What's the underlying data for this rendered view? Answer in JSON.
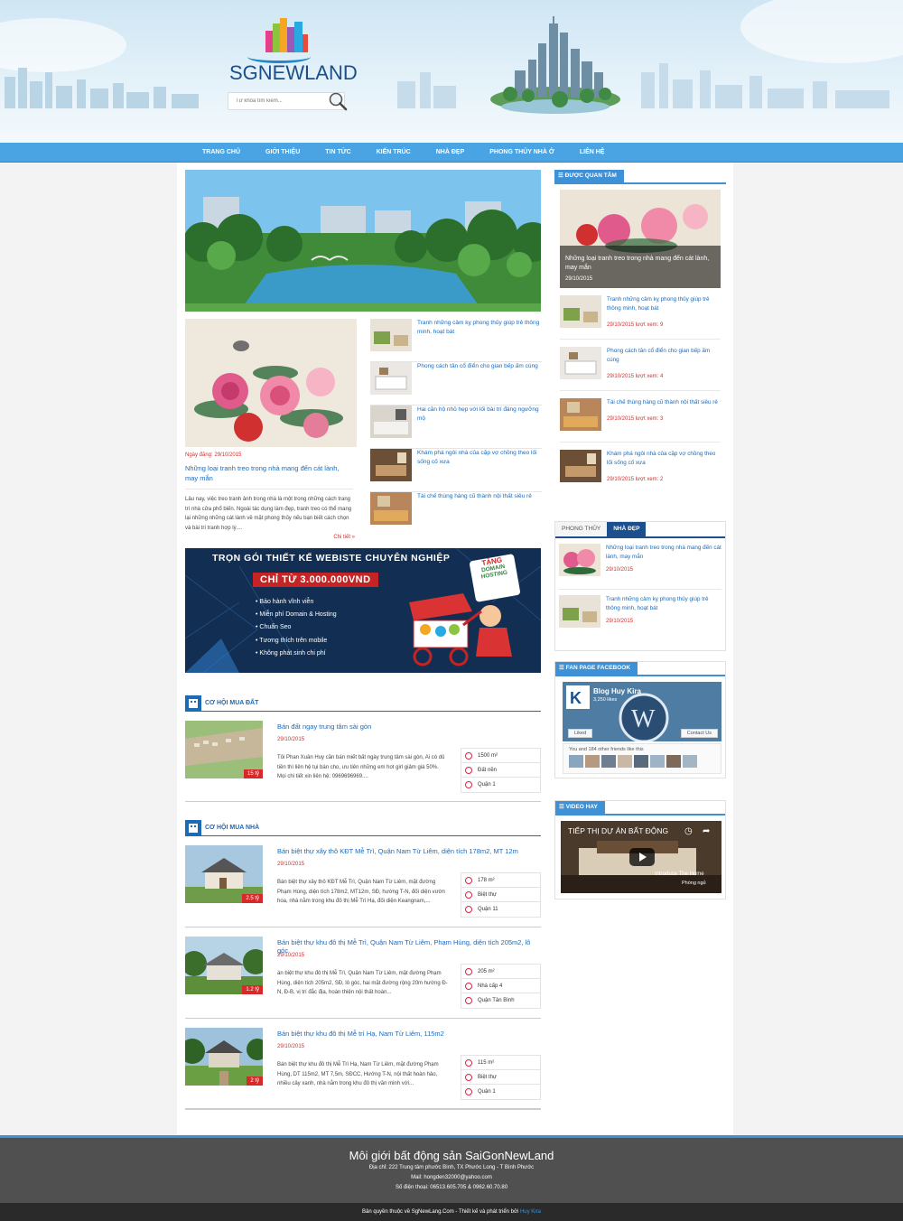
{
  "header": {
    "logo_text": "SGNEWLAND",
    "search_placeholder": "Từ khóa tìm kiếm..."
  },
  "nav": [
    "TRANG CHỦ",
    "GIỚI THIỆU",
    "TIN TỨC",
    "KIẾN TRÚC",
    "NHÀ ĐẸP",
    "PHONG THỦY NHÀ Ở",
    "LIÊN HỆ"
  ],
  "featured": {
    "date": "Ngày đăng: 29/10/2015",
    "title": "Những loại tranh treo trong nhà mang đến cát lành, may mắn",
    "excerpt": "Lâu nay, việc treo tranh ảnh trong nhà là một trong những cách trang trí nhà cửa phổ biến. Ngoài tác dụng làm đẹp, tranh treo có thể mang lại những những cát lành về mặt phong thủy nếu bạn biết cách chọn và bài trí tranh hợp lý....",
    "more": "Chi tiết »"
  },
  "small_list": [
    "Tranh những cảm kỵ phong thủy giúp trẻ thông minh, hoạt bát",
    "Phong cách tân cổ điển cho gian bếp ấm cúng",
    "Hai căn hộ nhỏ hẹp với lối bài trí đáng ngưỡng mộ",
    "Khám phá ngôi nhà của cặp vợ chồng theo lối sống cố xưa",
    "Tái chế thùng hàng cũ thành nội thất siêu rẻ"
  ],
  "banner": {
    "headline": "TRỌN GÓI THIẾT KẾ WEBISTE CHUYÊN NGHIỆP",
    "price": "CHỈ TỪ 3.000.000VND",
    "gift": [
      "TẶNG",
      "DOMAIN",
      "HOSTING"
    ],
    "features": [
      "Bảo hành vĩnh viễn",
      "Miễn phí Domain & Hosting",
      "Chuẩn Seo",
      "Tương thích trên mobile",
      "Không phát sinh chi phí"
    ]
  },
  "section_land": {
    "title": "CƠ HỘI MUA ĐẤT",
    "items": [
      {
        "title": "Bán đất ngay trung tâm sài gòn",
        "date": "29/10/2015",
        "desc": "Tôi Phan Xuân Huy cần bán miết bất ngày trung tâm sài gòn, Ai có dủ tiền thì liên hệ tụi bán cho, ưu tiên những em hot girl giảm giá 50%. Mọi chi tiết xin liên hệ: 0969696969....",
        "price": "15 tỷ",
        "area": "1500 m²",
        "type": "Đất nền",
        "district": "Quận 1"
      }
    ]
  },
  "section_house": {
    "title": "CƠ HỘI MUA NHÀ",
    "items": [
      {
        "title": "Bán biệt thự xây thô KĐT Mễ Trì, Quận Nam Từ Liêm, diện tích 178m2, MT 12m",
        "date": "29/10/2015",
        "desc": "Bán biệt thự xây thô KĐT Mễ Trì, Quận Nam Từ Liêm, mặt đường Phạm Hùng, diện tích 178m2, MT12m, SĐ, hướng T-N, đối diện vườn hoa, nhà nằm trong khu đô thị Mễ Trì Hạ, đối diện Keangnam,...",
        "price": "2.5 tỷ",
        "area": "178 m²",
        "type": "Biệt thự",
        "district": "Quận 11"
      },
      {
        "title": "Bán biệt thự khu đô thị Mễ Trì, Quận Nam Từ Liêm, Phạm Hùng, diện tích 205m2, lô góc",
        "date": "29/10/2015",
        "desc": "án biệt thự khu đô thị Mễ Trì, Quận Nam Từ Liêm, mặt đường Phạm Hùng, diện tích 205m2, SĐ, lô góc, hai mặt đường rộng 20m hướng Đ-N, Đ-B, vị trí đắc địa, hoàn thiện nội thất hoàn...",
        "price": "1.2 tỷ",
        "area": "205 m²",
        "type": "Nhà cấp 4",
        "district": "Quận Tân Bình"
      },
      {
        "title": "Bán biệt thự khu đô thị Mễ trì Hạ, Nam Từ Liêm, 115m2",
        "date": "29/10/2015",
        "desc": "Bán biệt thự khu đô thị Mễ Trì Hạ, Nam Từ Liêm, mặt đường Phạm Hùng, DT 115m2, MT 7,5m, SĐCC, Hướng T-N, nội thất hoàn hảo, nhiều cây xanh, nhà nằm trong khu đô thị văn minh với...",
        "price": "2 tỷ",
        "area": "115 m²",
        "type": "Biệt thự",
        "district": "Quận 1"
      }
    ]
  },
  "sidebar": {
    "popular_title": "ĐƯỢC QUAN TÂM",
    "popular_feature": {
      "title": "Những loại tranh treo trong nhà mang đến cát lành, may mắn",
      "date": "29/10/2015"
    },
    "popular_items": [
      {
        "title": "Tranh những cảm kỵ phong thủy giúp trẻ thông minh, hoạt bát",
        "meta": "29/10/2015 lượt xem: 9"
      },
      {
        "title": "Phong cách tân cổ điển cho gian bếp ấm cúng",
        "meta": "29/10/2015 lượt xem: 4"
      },
      {
        "title": "Tái chế thùng hàng cũ thành nội thất siêu rẻ",
        "meta": "29/10/2015 lượt xem: 3"
      },
      {
        "title": "Khám phá ngôi nhà của cặp vợ chồng theo lối sống cố xưa",
        "meta": "29/10/2015 lượt xem: 2"
      }
    ],
    "tabs": [
      "PHONG THỦY",
      "NHÀ ĐẸP"
    ],
    "tab_items": [
      {
        "title": "Những loại tranh treo trong nhà mang đến cát lành, may mắn",
        "date": "29/10/2015"
      },
      {
        "title": "Tranh những cảm kỵ phong thủy giúp trẻ thông minh, hoạt bát",
        "date": "29/10/2015"
      }
    ],
    "fanpage_title": "FAN PAGE FACEBOOK",
    "fb": {
      "name": "Blog Huy Kira",
      "likes": "3,250 likes",
      "liked": "Liked",
      "contact": "Contact Us",
      "friends": "You and 184 other friends like this"
    },
    "video_title": "VIDEO HAY",
    "video": {
      "title": "TIẾP THỊ DỰ ÁN BẤT ĐỘNG",
      "caption1": "Introduce The Home",
      "caption2": "Phòng ngủ"
    }
  },
  "footer": {
    "title": "Môi giới bất động sản SaiGonNewLand",
    "address": "Địa chỉ: 222 Trung tâm phước Bình, TX Phước Long - T Bình Phước",
    "mail": "Mail: hongden32000@yahoo.com",
    "phone": "Số điện thoại: 06513.605.705 & 0962.60.70.80",
    "copyright": "Bản quyền thuộc về SgNewLang.Com - Thiết kế và phát triển bởi",
    "author": "Huy Kira"
  }
}
